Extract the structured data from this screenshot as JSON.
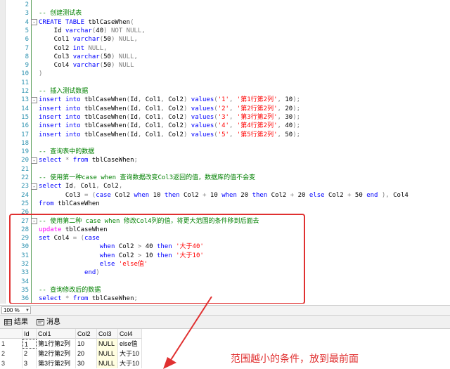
{
  "editor": {
    "lines": [
      {
        "n": "2",
        "html": ""
      },
      {
        "n": "3",
        "html": "<span class=\"c\">-- 创建测试表</span>"
      },
      {
        "n": "4",
        "html": "<span class=\"k\">CREATE TABLE</span> tblCaseWhen<span class=\"g\">(</span>"
      },
      {
        "n": "5",
        "html": "    Id <span class=\"k\">varchar</span><span class=\"g\">(</span>40<span class=\"g\">)</span> <span class=\"g\">NOT NULL,</span>"
      },
      {
        "n": "6",
        "html": "    Col1 <span class=\"k\">varchar</span><span class=\"g\">(</span>50<span class=\"g\">)</span> <span class=\"g\">NULL,</span>"
      },
      {
        "n": "7",
        "html": "    Col2 <span class=\"k\">int</span> <span class=\"g\">NULL,</span>"
      },
      {
        "n": "8",
        "html": "    Col3 <span class=\"k\">varchar</span><span class=\"g\">(</span>50<span class=\"g\">)</span> <span class=\"g\">NULL,</span>"
      },
      {
        "n": "9",
        "html": "    Col4 <span class=\"k\">varchar</span><span class=\"g\">(</span>50<span class=\"g\">)</span> <span class=\"g\">NULL</span>"
      },
      {
        "n": "10",
        "html": "<span class=\"g\">)</span>"
      },
      {
        "n": "11",
        "html": ""
      },
      {
        "n": "12",
        "html": "<span class=\"c\">-- 插入测试数据</span>"
      },
      {
        "n": "13",
        "html": "<span class=\"k\">insert into</span> tblCaseWhen<span class=\"g\">(</span>Id<span class=\"g\">,</span> Col1<span class=\"g\">,</span> Col2<span class=\"g\">)</span> <span class=\"k\">values</span><span class=\"g\">(</span><span class=\"s\">'1'</span><span class=\"g\">,</span> <span class=\"s\">'第1行第2列'</span><span class=\"g\">,</span> 10<span class=\"g\">);</span>"
      },
      {
        "n": "14",
        "html": "<span class=\"k\">insert into</span> tblCaseWhen<span class=\"g\">(</span>Id<span class=\"g\">,</span> Col1<span class=\"g\">,</span> Col2<span class=\"g\">)</span> <span class=\"k\">values</span><span class=\"g\">(</span><span class=\"s\">'2'</span><span class=\"g\">,</span> <span class=\"s\">'第2行第2列'</span><span class=\"g\">,</span> 20<span class=\"g\">);</span>"
      },
      {
        "n": "15",
        "html": "<span class=\"k\">insert into</span> tblCaseWhen<span class=\"g\">(</span>Id<span class=\"g\">,</span> Col1<span class=\"g\">,</span> Col2<span class=\"g\">)</span> <span class=\"k\">values</span><span class=\"g\">(</span><span class=\"s\">'3'</span><span class=\"g\">,</span> <span class=\"s\">'第3行第2列'</span><span class=\"g\">,</span> 30<span class=\"g\">);</span>"
      },
      {
        "n": "16",
        "html": "<span class=\"k\">insert into</span> tblCaseWhen<span class=\"g\">(</span>Id<span class=\"g\">,</span> Col1<span class=\"g\">,</span> Col2<span class=\"g\">)</span> <span class=\"k\">values</span><span class=\"g\">(</span><span class=\"s\">'4'</span><span class=\"g\">,</span> <span class=\"s\">'第4行第2列'</span><span class=\"g\">,</span> 40<span class=\"g\">);</span>"
      },
      {
        "n": "17",
        "html": "<span class=\"k\">insert into</span> tblCaseWhen<span class=\"g\">(</span>Id<span class=\"g\">,</span> Col1<span class=\"g\">,</span> Col2<span class=\"g\">)</span> <span class=\"k\">values</span><span class=\"g\">(</span><span class=\"s\">'5'</span><span class=\"g\">,</span> <span class=\"s\">'第5行第2列'</span><span class=\"g\">,</span> 50<span class=\"g\">);</span>"
      },
      {
        "n": "18",
        "html": ""
      },
      {
        "n": "19",
        "html": "<span class=\"c\">-- 查询表中的数据</span>"
      },
      {
        "n": "20",
        "html": "<span class=\"k\">select</span> <span class=\"g\">*</span> <span class=\"k\">from</span> tblCaseWhen<span class=\"g\">;</span>"
      },
      {
        "n": "21",
        "html": ""
      },
      {
        "n": "22",
        "html": "<span class=\"c\">-- 使用第一种case when 查询数据改变Col3返回的值，数据库的值不会变</span>"
      },
      {
        "n": "23",
        "html": "<span class=\"k\">select</span> Id<span class=\"g\">,</span> Col1<span class=\"g\">,</span> Col2<span class=\"g\">,</span>"
      },
      {
        "n": "24",
        "html": "       Col3 <span class=\"g\">=</span> <span class=\"g\">(</span><span class=\"k\">case</span> Col2 <span class=\"k\">when</span> 10 <span class=\"k\">then</span> Col2 <span class=\"g\">+</span> 10 <span class=\"k\">when</span> 20 <span class=\"k\">then</span> Col2 <span class=\"g\">+</span> 20 <span class=\"k\">else</span> Col2 <span class=\"g\">+</span> 50 <span class=\"k\">end</span> <span class=\"g\">),</span> Col4"
      },
      {
        "n": "25",
        "html": "<span class=\"k\">from</span> tblCaseWhen"
      },
      {
        "n": "26",
        "html": ""
      },
      {
        "n": "27",
        "html": "<span class=\"c\">-- 使用第二种 case when 修改Col4列的值，将更大范围的条件移到后面去</span>"
      },
      {
        "n": "28",
        "html": "<span class=\"f\">update</span> tblCaseWhen"
      },
      {
        "n": "29",
        "html": "<span class=\"k\">set</span> Col4 <span class=\"g\">=</span> <span class=\"g\">(</span><span class=\"k\">case</span>"
      },
      {
        "n": "30",
        "html": "                <span class=\"k\">when</span> Col2 <span class=\"g\">&gt;</span> 40 <span class=\"k\">then</span> <span class=\"s\">'大于40'</span>"
      },
      {
        "n": "31",
        "html": "                <span class=\"k\">when</span> Col2 <span class=\"g\">&gt;</span> 10 <span class=\"k\">then</span> <span class=\"s\">'大于10'</span>"
      },
      {
        "n": "32",
        "html": "                <span class=\"k\">else</span> <span class=\"s\">'else值'</span>"
      },
      {
        "n": "33",
        "html": "            <span class=\"k\">end</span><span class=\"g\">)</span>"
      },
      {
        "n": "34",
        "html": ""
      },
      {
        "n": "35",
        "html": "<span class=\"c\">-- 查询修改后的数据</span>"
      },
      {
        "n": "36",
        "html": "<span class=\"k\">select</span> <span class=\"g\">*</span> <span class=\"k\">from</span> tblCaseWhen<span class=\"g\">;</span>"
      }
    ],
    "fold_marks": {
      "4": "-",
      "13": "-",
      "20": "-",
      "23": "-",
      "27": "-"
    }
  },
  "zoom": {
    "value": "100 %"
  },
  "tabs": [
    {
      "label": "结果",
      "icon": "grid-icon"
    },
    {
      "label": "消息",
      "icon": "message-icon"
    }
  ],
  "results": {
    "columns": [
      "Id",
      "Col1",
      "Col2",
      "Col3",
      "Col4"
    ],
    "rows": [
      {
        "rn": "1",
        "cells": [
          "1",
          "第1行第2列",
          "10",
          "NULL",
          "else值"
        ]
      },
      {
        "rn": "2",
        "cells": [
          "2",
          "第2行第2列",
          "20",
          "NULL",
          "大于10"
        ]
      },
      {
        "rn": "3",
        "cells": [
          "3",
          "第3行第2列",
          "30",
          "NULL",
          "大于10"
        ]
      }
    ]
  },
  "annotation": {
    "text": "范围越小的条件，放到最前面",
    "color": "#e03030"
  }
}
